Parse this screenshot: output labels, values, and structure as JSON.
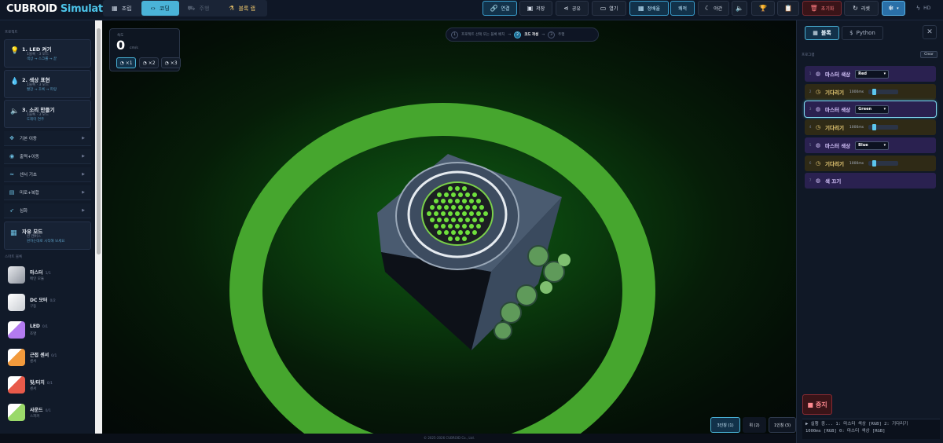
{
  "header": {
    "logo_main": "CUBROID",
    "logo_sub": "Simulator",
    "tabs": [
      {
        "label": "조립",
        "icon": "grid-icon"
      },
      {
        "label": "코딩",
        "icon": "code-icon"
      },
      {
        "label": "주행",
        "icon": "car-icon"
      },
      {
        "label": "블록 랩",
        "icon": "flask-icon"
      }
    ],
    "buttons": {
      "connect": "연결",
      "save": "저장",
      "share": "공유",
      "open": "열기",
      "dual": "정배율",
      "fast": "쾌적",
      "night": "야간",
      "reset_all": "초기화",
      "reset": "리셋",
      "quality": "HD"
    }
  },
  "sidebar": {
    "section_project": "프로젝트",
    "cards": [
      {
        "title": "1. LED 켜기",
        "sub": "1블록 · 3 모드",
        "flow": "색상 → 스크롤 → 끝"
      },
      {
        "title": "2. 색상 표현",
        "sub": "1블록 · 3 모드",
        "flow": "빨강 → 초록 → 파랑"
      },
      {
        "title": "3. 소리 만들기",
        "sub": "1블록 · 3 모드",
        "flow": "도레미 연주"
      }
    ],
    "groups": [
      "기본 이동",
      "출력+이동",
      "센서 기초",
      "미로+복합",
      "심화"
    ],
    "free": {
      "title": "자유 모드",
      "sub": "빈 캔버스",
      "flow": "원하는대로 시작해 보세요"
    },
    "section_smart": "스마트 블록",
    "modules": [
      {
        "name": "마스터",
        "count": "1/1",
        "desc": "메인 모듈",
        "color": "#cfd3da"
      },
      {
        "name": "DC 모터",
        "count": "0/2",
        "desc": "구동",
        "color": "#f2f2f2"
      },
      {
        "name": "LED",
        "count": "0/1",
        "desc": "조명",
        "color": "#b37bf0"
      },
      {
        "name": "근접 센서",
        "count": "0/1",
        "desc": "센서",
        "color": "#f29a3c"
      },
      {
        "name": "빛/터치",
        "count": "0/1",
        "desc": "센서",
        "color": "#e85a4a"
      },
      {
        "name": "사운드",
        "count": "0/1",
        "desc": "스피커",
        "color": "#9ad96a"
      }
    ]
  },
  "viewport": {
    "speed_label": "속도",
    "speed_value": "0",
    "speed_unit": "cm/s",
    "speed_buttons": [
      "×1",
      "×2",
      "×3"
    ],
    "steps": [
      {
        "num": "1",
        "label": "프로젝트 선택 또는 블록 배치"
      },
      {
        "num": "2",
        "label": "코드 작성"
      },
      {
        "num": "3",
        "label": "주행"
      }
    ],
    "views": [
      "3인칭 (1)",
      "위 (2)",
      "1인칭 (3)"
    ],
    "footer": "© 2025-2026 CUBROID Co., Ltd."
  },
  "panel": {
    "tabs": [
      "블록",
      "Python"
    ],
    "program_label": "프로그램",
    "clear": "Clear",
    "blocks": [
      {
        "n": "1",
        "label": "마스터 색상",
        "type": "color",
        "value": "Red"
      },
      {
        "n": "2",
        "label": "기다리기",
        "type": "wait",
        "ms": "1000ms"
      },
      {
        "n": "3",
        "label": "마스터 색상",
        "type": "color",
        "value": "Green"
      },
      {
        "n": "4",
        "label": "기다리기",
        "type": "wait",
        "ms": "1000ms"
      },
      {
        "n": "5",
        "label": "마스터 색상",
        "type": "color",
        "value": "Blue"
      },
      {
        "n": "6",
        "label": "기다리기",
        "type": "wait",
        "ms": "1000ms"
      },
      {
        "n": "7",
        "label": "색 끄기",
        "type": "color"
      }
    ],
    "stop": "중지",
    "log_line1": "▶ 실행 중... 1: 마스터 색상 [RGB] 2: 기다리기",
    "log_line2": "1000ms [RGB] 0: 마스터 색상 [RGB]"
  }
}
